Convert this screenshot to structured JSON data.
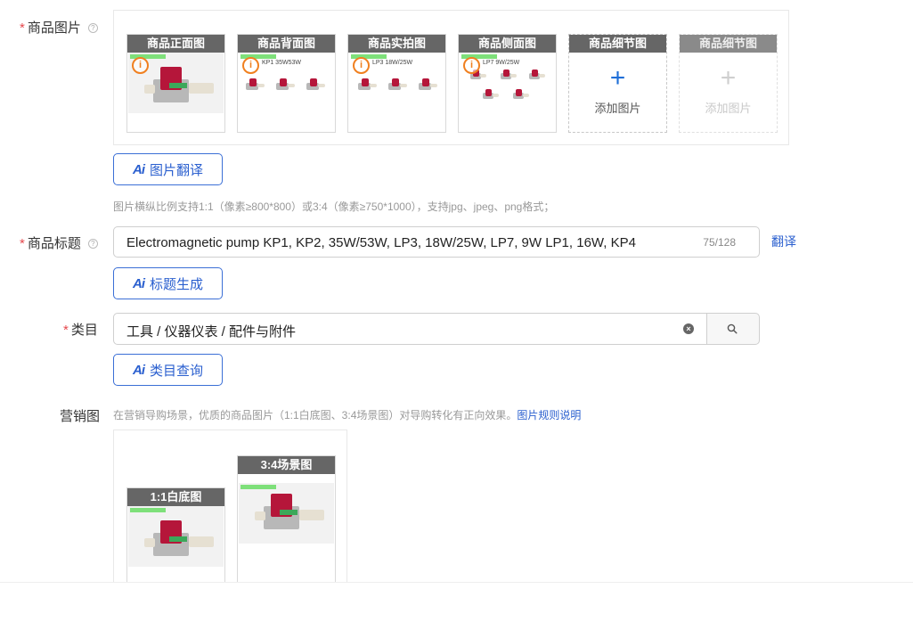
{
  "product_images": {
    "label": "商品图片",
    "required_mark": "*",
    "help": "?",
    "slots": [
      {
        "title": "商品正面图",
        "caption": ""
      },
      {
        "title": "商品背面图",
        "caption": "KP1 35W53W"
      },
      {
        "title": "商品实拍图",
        "caption": "LP3 18W/25W"
      },
      {
        "title": "商品侧面图",
        "caption": "LP7 9W/25W"
      }
    ],
    "add_slots": [
      {
        "title": "商品细节图",
        "add_label": "添加图片",
        "plus": "+"
      },
      {
        "title": "商品细节图",
        "add_label": "添加图片",
        "plus": "+"
      }
    ],
    "warn_symbol": "i",
    "ai_button": {
      "ai": "Ai",
      "label": "图片翻译"
    },
    "hint": "图片横纵比例支持1:1（像素≥800*800）或3:4（像素≥750*1000），支持jpg、jpeg、png格式；"
  },
  "title_field": {
    "label": "商品标题",
    "required_mark": "*",
    "help": "?",
    "value": "Electromagnetic pump KP1, KP2, 35W/53W, LP3, 18W/25W, LP7, 9W LP1, 16W, KP4",
    "counter": "75/128",
    "translate": "翻译",
    "ai_button": {
      "ai": "Ai",
      "label": "标题生成"
    }
  },
  "category_field": {
    "label": "类目",
    "required_mark": "*",
    "value": "工具 / 仪器仪表 / 配件与附件",
    "clear": "×",
    "ai_button": {
      "ai": "Ai",
      "label": "类目查询"
    }
  },
  "marketing": {
    "label": "营销图",
    "hint": "在营销导购场景，优质的商品图片（1:1白底图、3:4场景图）对导购转化有正向效果。",
    "hint_link": "图片规则说明",
    "slots": [
      {
        "title": "1:1白底图"
      },
      {
        "title": "3:4场景图"
      }
    ]
  },
  "colors": {
    "accent": "#2a5fcf",
    "required": "#e5484d",
    "slot_header": "#666666",
    "warning": "#f08020"
  }
}
